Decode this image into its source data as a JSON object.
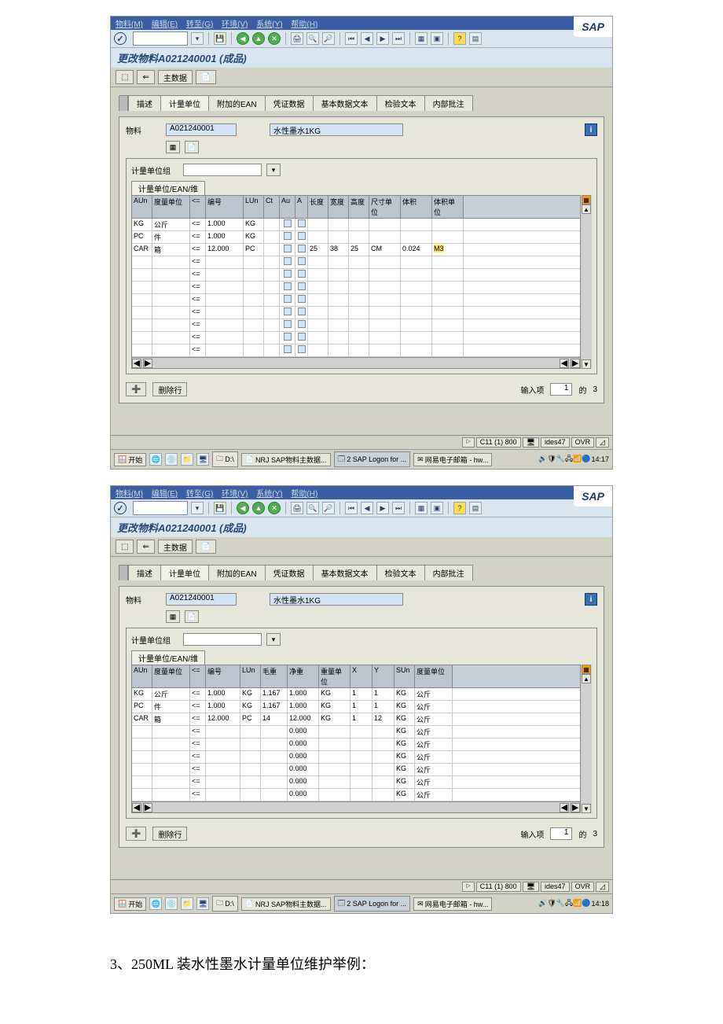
{
  "menu": {
    "material": "物料(M)",
    "edit": "编辑(E)",
    "goto": "转至(G)",
    "env": "环境(V)",
    "system": "系统(Y)",
    "help": "帮助(H)"
  },
  "page_title": "更改物料A021240001 (成品)",
  "toolbar_btn": {
    "back": "⇐",
    "main": "主数据"
  },
  "tabs": {
    "desc": "描述",
    "uom": "计量单位",
    "ean": "附加的EAN",
    "doc": "凭证数据",
    "basic": "基本数据文本",
    "insp": "检验文本",
    "note": "内部批注"
  },
  "material": {
    "label": "物料",
    "code": "A021240001",
    "desc": "水性墨水1KG"
  },
  "group": {
    "label": "计量单位组"
  },
  "subtab": {
    "uom_ean": "计量单位/EAN/维"
  },
  "grid1": {
    "cols": [
      "AUn",
      "度量单位",
      "<=",
      "编号",
      "LUn",
      "Ct",
      "Au",
      "A",
      "长度",
      "宽度",
      "高度",
      "尺寸单位",
      "体积",
      "体积单位"
    ],
    "rows": [
      {
        "aun": "KG",
        "du": "公斤",
        "op": "<=",
        "num": "1.000",
        "lun": "KG"
      },
      {
        "aun": "PC",
        "du": "件",
        "op": "<=",
        "num": "1.000",
        "lun": "KG"
      },
      {
        "aun": "CAR",
        "du": "箱",
        "op": "<=",
        "num": "12.000",
        "lun": "PC",
        "l": "25",
        "w": "38",
        "h": "25",
        "su": "CM",
        "vol": "0.024",
        "vu": "M3",
        "vu_hl": true
      }
    ],
    "empty_op": "<="
  },
  "grid2": {
    "cols": [
      "AUn",
      "度量单位",
      "<=",
      "编号",
      "LUn",
      "毛重",
      "净重",
      "重量单位",
      "X",
      "Y",
      "SUn",
      "度量单位"
    ],
    "rows": [
      {
        "aun": "KG",
        "du": "公斤",
        "op": "<=",
        "num": "1.000",
        "lun": "KG",
        "gw": "1.167",
        "nw": "1.000",
        "wu": "KG",
        "x": "1",
        "y": "1",
        "sun": "KG",
        "sdu": "公斤"
      },
      {
        "aun": "PC",
        "du": "件",
        "op": "<=",
        "num": "1.000",
        "lun": "KG",
        "gw": "1.167",
        "nw": "1.000",
        "wu": "KG",
        "x": "1",
        "y": "1",
        "sun": "KG",
        "sdu": "公斤"
      },
      {
        "aun": "CAR",
        "du": "箱",
        "op": "<=",
        "num": "12.000",
        "lun": "PC",
        "gw": "14",
        "nw": "12.000",
        "wu": "KG",
        "x": "1",
        "y": "12",
        "sun": "KG",
        "sdu": "公斤"
      }
    ],
    "empty": {
      "nw": "0.000",
      "sun": "KG",
      "sdu": "公斤"
    },
    "empty_op": "<="
  },
  "footer": {
    "delete": "删除行",
    "entry_label": "输入项",
    "entry": "1",
    "of": "的",
    "total": "3"
  },
  "status": {
    "sys": "C11 (1) 800",
    "user": "ides47",
    "mode": "OVR"
  },
  "taskbar": {
    "start": "开始",
    "drive": "D:\\",
    "tasks": [
      {
        "label": "NRJ SAP物料主数据..."
      },
      {
        "label": "2 SAP Logon for ...",
        "active": true
      },
      {
        "label": "网易电子邮箱 - hw..."
      }
    ],
    "time1": "14:17",
    "time2": "14:18"
  },
  "footnote": "3、250ML 装水性墨水计量单位维护举例："
}
